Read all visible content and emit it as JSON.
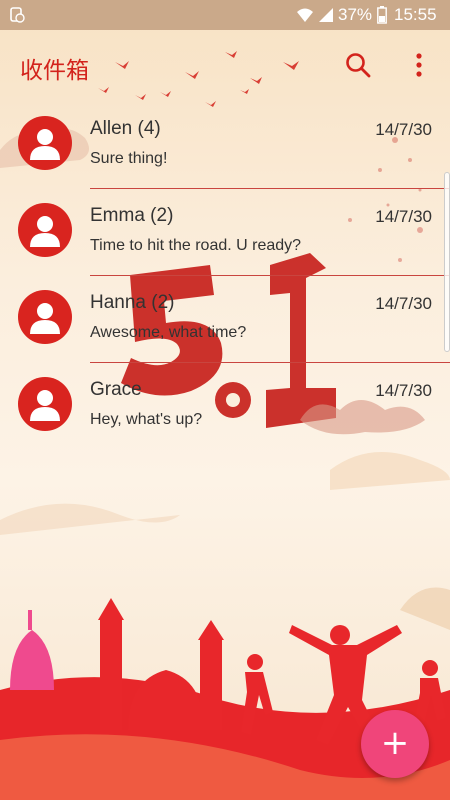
{
  "status_bar": {
    "battery": "37%",
    "time": "15:55",
    "icons": [
      "notification-icon",
      "wifi-icon",
      "signal-icon",
      "battery-icon"
    ]
  },
  "app_bar": {
    "title": "收件箱",
    "actions": [
      "search-icon",
      "more-vert-icon"
    ]
  },
  "messages": [
    {
      "sender": "Allen (4)",
      "date": "14/7/30",
      "preview": "Sure thing!"
    },
    {
      "sender": "Emma (2)",
      "date": "14/7/30",
      "preview": "Time to hit the road. U ready?"
    },
    {
      "sender": "Hanna (2)",
      "date": "14/7/30",
      "preview": "Awesome, what time?"
    },
    {
      "sender": "Grace",
      "date": "14/7/30",
      "preview": "Hey, what's up?"
    }
  ],
  "fab": {
    "label": "+",
    "icon": "plus-icon"
  },
  "colors": {
    "accent": "#d3231c",
    "fab": "#f0457a",
    "status_bar": "#caa98a",
    "background": "#fbeedd"
  }
}
